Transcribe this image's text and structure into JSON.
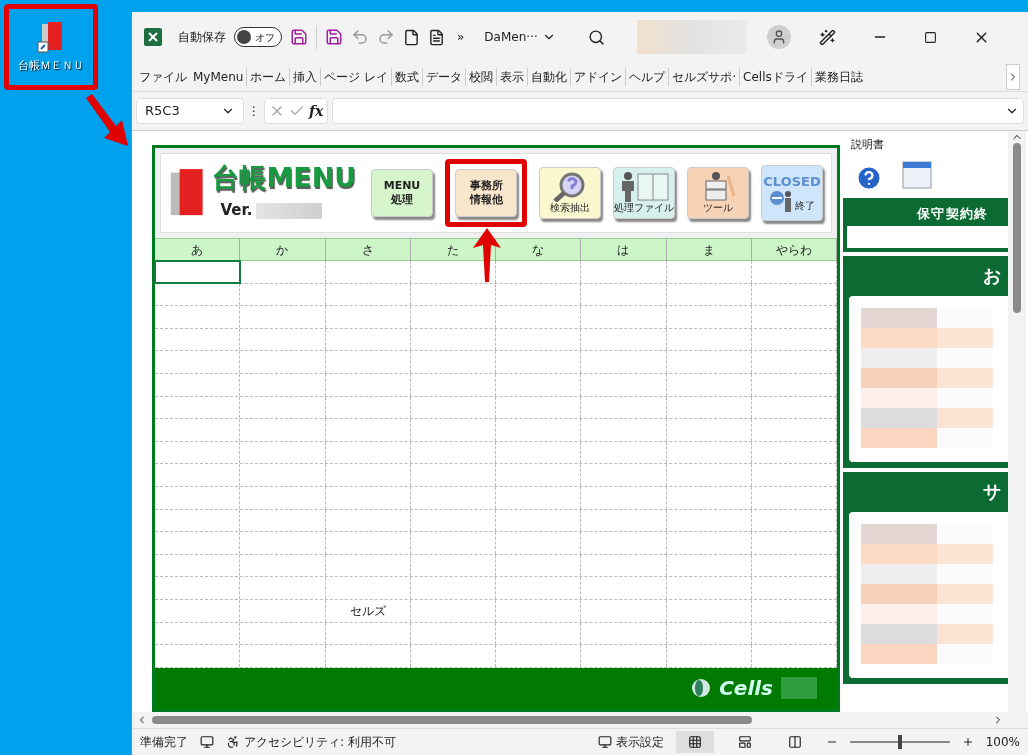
{
  "desktop_icon": {
    "label": "台帳ＭＥＮＵ",
    "annotated": true
  },
  "titlebar": {
    "autosave_label": "自動保存",
    "autosave_toggle": {
      "label": "オフ",
      "on": false
    },
    "more": "»",
    "filename": "DaMen···"
  },
  "ribbon_tabs": [
    "ファイル",
    "MyMenu",
    "ホーム",
    "挿入",
    "ページ レイ",
    "数式",
    "データ",
    "校閲",
    "表示",
    "自動化",
    "アドイン",
    "ヘルプ",
    "セルズサポ·",
    "Cellsドライ",
    "業務日誌"
  ],
  "formula_bar": {
    "name_box": "R5C3",
    "separator": "⋮",
    "fx": "fx"
  },
  "sheet": {
    "title": "台帳MENU",
    "version_label": "Ver.",
    "buttons": [
      {
        "kind": "text",
        "lines": [
          "MENU",
          "処理"
        ],
        "color": "#d6f5cc",
        "annotated": false
      },
      {
        "kind": "text",
        "lines": [
          "事務所",
          "情報他"
        ],
        "color": "#f8e6cc",
        "annotated": true
      },
      {
        "kind": "search",
        "lines": [
          "検索抽出"
        ],
        "color": "#fbf8cf",
        "annotated": false
      },
      {
        "kind": "files",
        "lines": [
          "処理ファイル"
        ],
        "color": "#d6f0ee",
        "annotated": false
      },
      {
        "kind": "tools",
        "lines": [
          "ツール"
        ],
        "color": "#f8d2b4",
        "annotated": false
      },
      {
        "kind": "closed",
        "lines": [
          "CLOSED",
          "終了"
        ],
        "color": "#cfe5fb",
        "annotated": false
      }
    ],
    "columns": [
      "あ",
      "か",
      "さ",
      "た",
      "な",
      "は",
      "ま",
      "やらわ"
    ],
    "entries": [
      {
        "text": "セルズ"
      }
    ],
    "footer_brand": "Cells"
  },
  "side_panel": {
    "manual_label": "説明書",
    "sections": [
      {
        "title": "保守契約終",
        "kind": "bar"
      },
      {
        "title": "お",
        "kind": "table"
      },
      {
        "title": "サ",
        "kind": "table"
      }
    ]
  },
  "status_bar": {
    "ready": "準備完了",
    "accessibility": "アクセシビリティ: 利用不可",
    "display_settings": "表示設定",
    "views": [
      {
        "kind": "normal",
        "selected": true
      },
      {
        "kind": "page_layout",
        "selected": false
      },
      {
        "kind": "page_break",
        "selected": false
      }
    ],
    "zoom": {
      "level": 0.5,
      "label": "100%"
    }
  }
}
